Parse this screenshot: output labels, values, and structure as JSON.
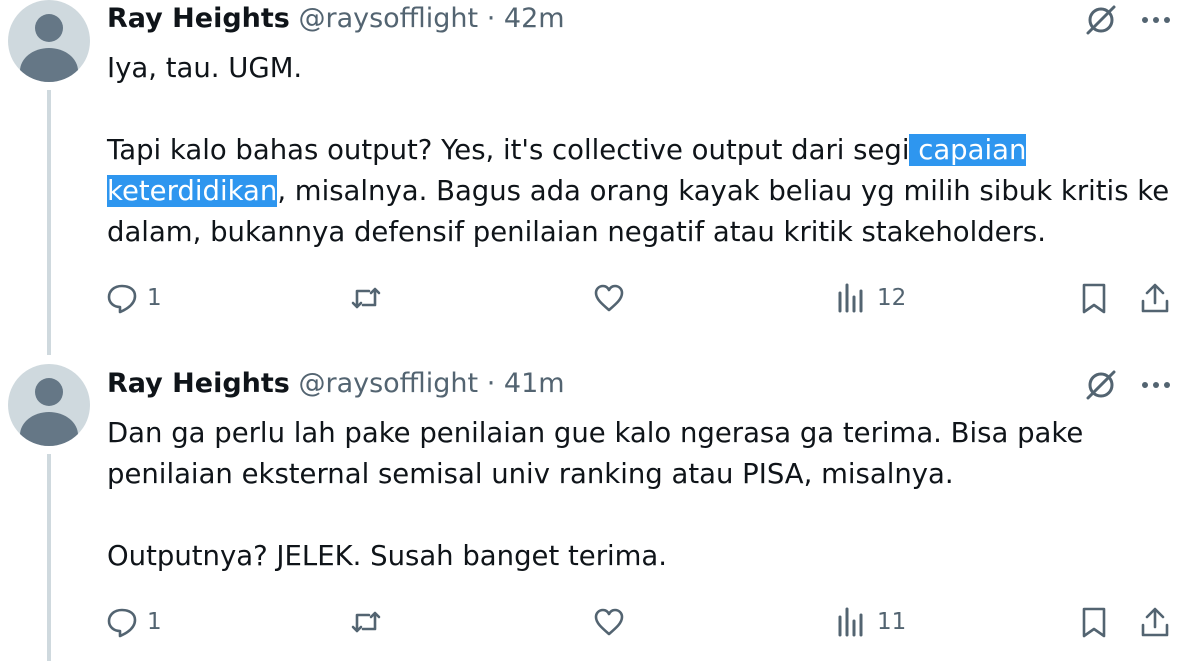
{
  "tweets": [
    {
      "name": "Ray Heights",
      "handle": "@raysofflight",
      "separator": "·",
      "time": "42m",
      "text": {
        "line1": "Iya, tau. UGM.",
        "p2_before": "Tapi kalo bahas output? Yes, it's collective output dari segi",
        "p2_highlight_a": " capaian ",
        "p2_highlight_b": "keterdidikan",
        "p2_after": ", misalnya. Bagus ada orang kayak beliau yg milih sibuk kritis ke dalam, bukannya defensif penilaian negatif atau kritik stakeholders."
      },
      "replies": "1",
      "views": "12"
    },
    {
      "name": "Ray Heights",
      "handle": "@raysofflight",
      "separator": "·",
      "time": "41m",
      "text": {
        "p1": "Dan ga perlu lah pake penilaian gue kalo ngerasa ga terima. Bisa pake penilaian eksternal semisal univ ranking atau PISA, misalnya.",
        "p2": "Outputnya? JELEK. Susah banget terima."
      },
      "replies": "1",
      "views": "11"
    }
  ],
  "icons": {
    "grok": "grok-icon",
    "more": "more-icon",
    "reply": "reply-icon",
    "retweet": "retweet-icon",
    "like": "like-icon",
    "views": "views-icon",
    "bookmark": "bookmark-icon",
    "share": "share-icon"
  },
  "colors": {
    "text": "#0f1419",
    "secondary": "#536471",
    "highlight": "#2e96ef",
    "avatar_bg": "#cfd9de",
    "avatar_fg": "#657786"
  }
}
